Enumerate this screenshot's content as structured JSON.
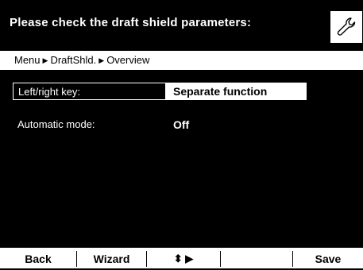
{
  "header": {
    "title": "Please check the draft shield parameters:",
    "settings_icon": "wrench-icon"
  },
  "breadcrumb": {
    "items": [
      "Menu",
      "DraftShld.",
      "Overview"
    ],
    "separator_icon": "triangle-right-icon"
  },
  "parameters": [
    {
      "label": "Left/right key:",
      "value": "Separate function",
      "selected": true
    },
    {
      "label": "Automatic mode:",
      "value": "Off",
      "selected": false
    }
  ],
  "softkeys": {
    "back": "Back",
    "wizard": "Wizard",
    "nav": "⬍ ▶",
    "empty": "",
    "save": "Save"
  },
  "colors": {
    "background": "#000000",
    "foreground": "#ffffff"
  }
}
